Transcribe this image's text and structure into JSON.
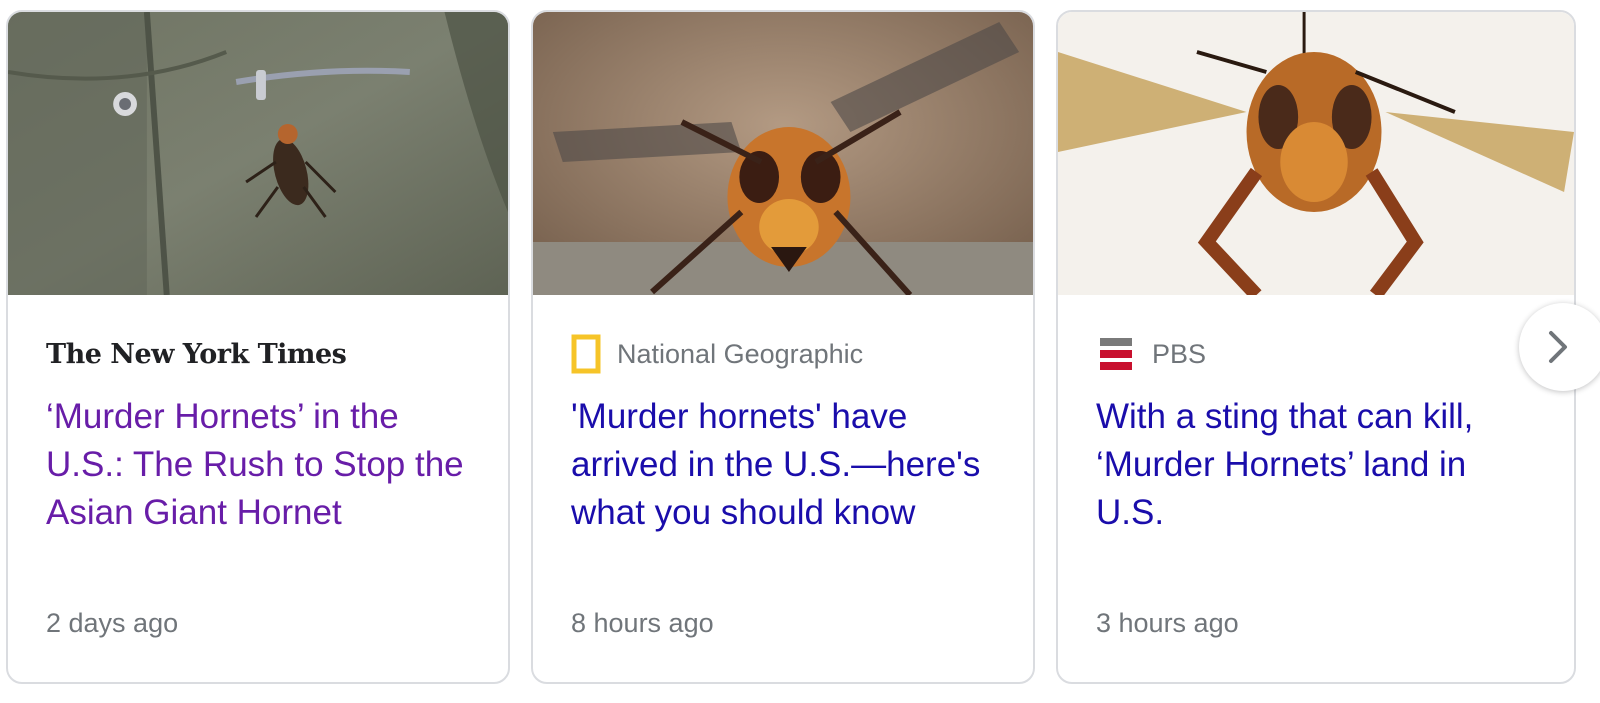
{
  "cards": [
    {
      "source": "The New York Times",
      "headline": "‘Murder Hornets’ in the U.S.: The Rush to Stop the Asian Giant Hornet",
      "time": "2 days ago"
    },
    {
      "source": "National Geographic",
      "headline": "'Murder hornets' have arrived in the U.S.—here's what you should know",
      "time": "8 hours ago"
    },
    {
      "source": "PBS",
      "headline": "With a sting that can kill, ‘Murder Hornets’ land in U.S.",
      "time": "3 hours ago"
    }
  ],
  "icons": {
    "next": "chevron-right-icon",
    "natgeo_logo": "natgeo-logo-icon",
    "pbs_logo": "pbs-newshour-logo-icon"
  },
  "colors": {
    "headline": "#1a0dab",
    "headline_visited": "#681da8",
    "meta": "#70757a",
    "border": "#dadce0",
    "natgeo_yellow": "#f6c428",
    "pbs_red": "#c8102e"
  }
}
